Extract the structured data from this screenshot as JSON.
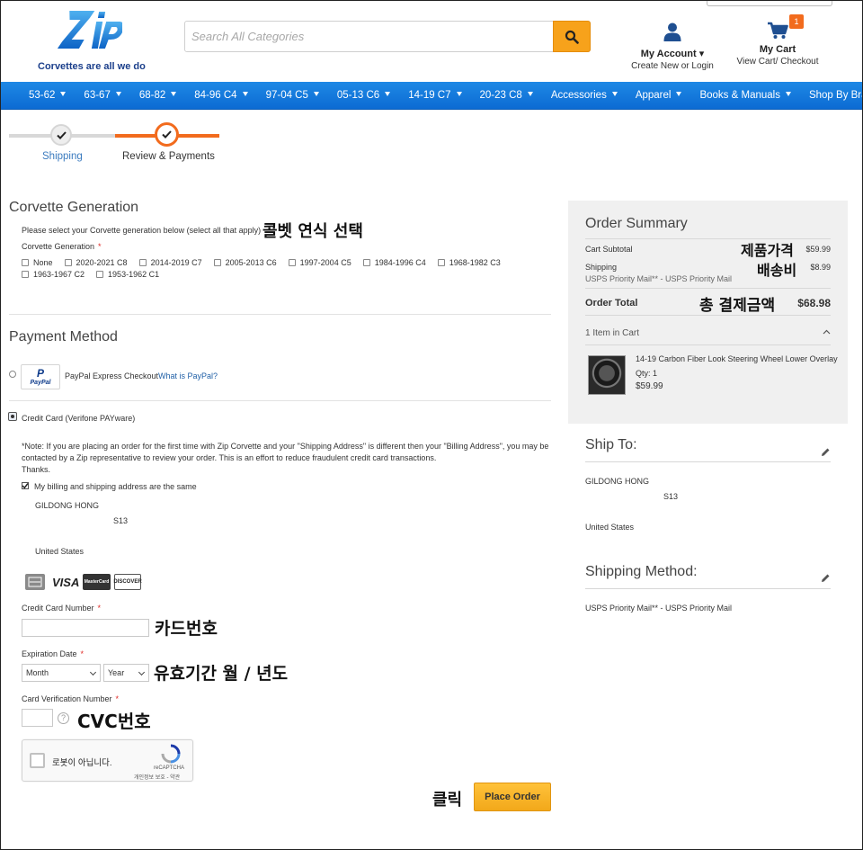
{
  "header": {
    "tagline": "Corvettes are all we do",
    "search_placeholder": "Search All Categories",
    "account_title": "My Account ▾",
    "account_sub": "Create New or Login",
    "cart_badge": "1",
    "cart_title": "My Cart",
    "cart_sub": "View Cart/ Checkout"
  },
  "nav": [
    "53-62",
    "63-67",
    "68-82",
    "84-96 C4",
    "97-04 C5",
    "05-13 C6",
    "14-19 C7",
    "20-23 C8",
    "Accessories",
    "Apparel",
    "Books & Manuals",
    "Shop By Brand"
  ],
  "progress": {
    "step1": "Shipping",
    "step2": "Review & Payments"
  },
  "generation": {
    "title": "Corvette Generation",
    "instruction": "Please select your Corvette generation below (select all that apply)",
    "field_label": "Corvette Generation",
    "required_mark": "*",
    "row1": [
      "None",
      "2020-2021 C8",
      "2014-2019 C7",
      "2005-2013 C6",
      "1997-2004 C5",
      "1984-1996 C4",
      "1968-1982 C3"
    ],
    "row2": [
      "1963-1967 C2",
      "1953-1962 C1"
    ]
  },
  "payment": {
    "title": "Payment Method",
    "paypal_logo": "P",
    "paypal_logo_text": "PayPal",
    "paypal_label": "PayPal Express Checkout",
    "paypal_link": "What is PayPal?",
    "cc_label": "Credit Card (Verifone PAYware)",
    "note_line1": "*Note: If you are placing an order for the first time with Zip Corvette and your \"Shipping Address\" is different then your \"Billing Address\", you may be",
    "note_line2": "contacted by a Zip representative to review your order. This is an effort to reduce fraudulent credit card transactions.",
    "note_line3": "Thanks.",
    "same_address": "My billing and shipping address are the same",
    "billing_name": "GILDONG HONG",
    "billing_addr": "S13",
    "billing_country": "United States",
    "card_logos": {
      "visa": "VISA",
      "mc": "MasterCard",
      "discover": "DISCOVER"
    },
    "card_number_label": "Credit Card Number",
    "exp_label": "Expiration Date",
    "month_value": "Month",
    "year_value": "Year",
    "cvv_label": "Card Verification Number",
    "help_glyph": "?",
    "captcha_text": "로봇이 아닙니다.",
    "captcha_brand": "reCAPTCHA",
    "captcha_terms": "개인정보 보호 - 약관",
    "place_order": "Place Order"
  },
  "annotations": {
    "generation": "콜벳 연식 선택",
    "price": "제품가격",
    "shipping": "배송비",
    "total": "총 결제금액",
    "card_number": "카드번호",
    "expiry": "유효기간 월 / 년도",
    "cvc": "CVC번호",
    "click": "클릭"
  },
  "summary": {
    "title": "Order Summary",
    "subtotal_label": "Cart Subtotal",
    "subtotal_value": "$59.99",
    "shipping_label": "Shipping",
    "shipping_method": "USPS Priority Mail** - USPS Priority Mail",
    "shipping_value": "$8.99",
    "total_label": "Order Total",
    "total_value": "$68.98",
    "items_label": "1 Item in Cart",
    "item_name": "14-19 Carbon Fiber Look Steering Wheel Lower Overlay",
    "item_qty": "Qty: 1",
    "item_price": "$59.99"
  },
  "ship_to": {
    "title": "Ship To:",
    "name": "GILDONG HONG",
    "addr": "S13",
    "country": "United States"
  },
  "ship_method": {
    "title": "Shipping Method:",
    "value": "USPS Priority Mail** - USPS Priority Mail"
  },
  "colors": {
    "accent": "#f26b1d",
    "nav": "#1677dc",
    "button": "#f7a21b",
    "link": "#3b7bbf"
  }
}
